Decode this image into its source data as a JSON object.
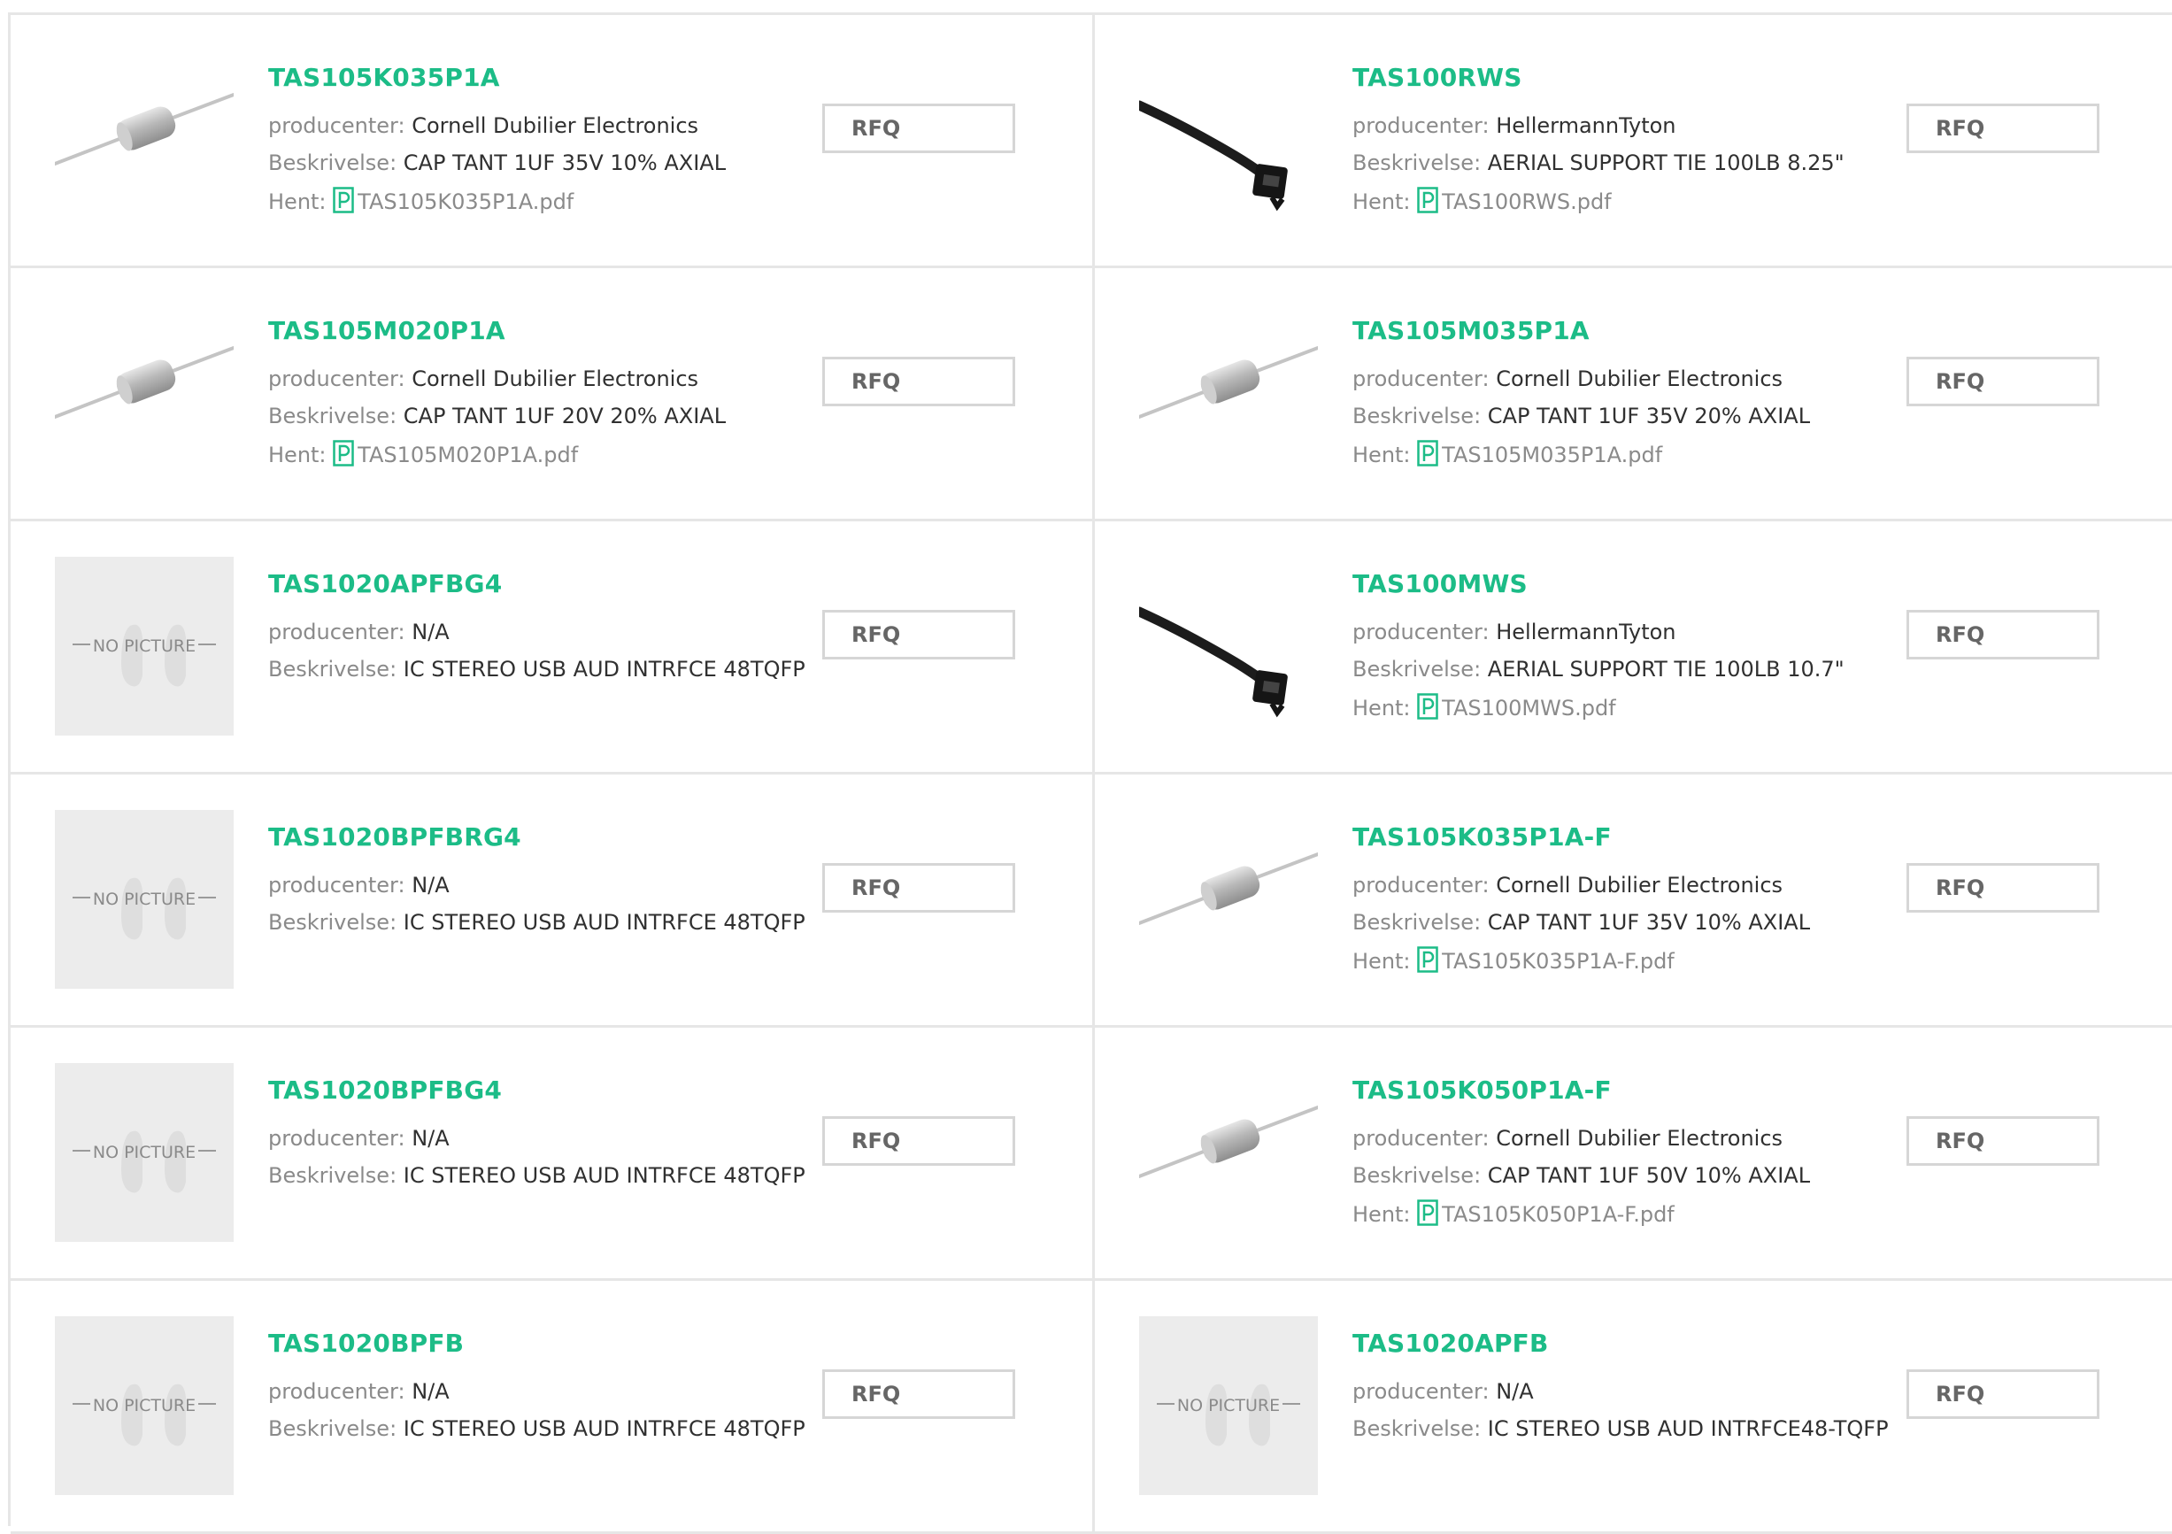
{
  "labels": {
    "manufacturer": "producenter:",
    "description": "Beskrivelse:",
    "download": "Hent:",
    "rfq": "RFQ",
    "no_picture": "NO PICTURE"
  },
  "colors": {
    "part_link": "#1cbc87",
    "label": "#8a8a8a",
    "value": "#303030",
    "border": "#e6e6e6"
  },
  "products": [
    {
      "part": "TAS105K035P1A",
      "manufacturer": "Cornell Dubilier Electronics",
      "description": "CAP TANT 1UF 35V 10% AXIAL",
      "pdf": "TAS105K035P1A.pdf",
      "image": "axial-capacitor"
    },
    {
      "part": "TAS100RWS",
      "manufacturer": "HellermannTyton",
      "description": "AERIAL SUPPORT TIE 100LB 8.25\"",
      "pdf": "TAS100RWS.pdf",
      "image": "cable-tie"
    },
    {
      "part": "TAS105M020P1A",
      "manufacturer": "Cornell Dubilier Electronics",
      "description": "CAP TANT 1UF 20V 20% AXIAL",
      "pdf": "TAS105M020P1A.pdf",
      "image": "axial-capacitor"
    },
    {
      "part": "TAS105M035P1A",
      "manufacturer": "Cornell Dubilier Electronics",
      "description": "CAP TANT 1UF 35V 20% AXIAL",
      "pdf": "TAS105M035P1A.pdf",
      "image": "axial-capacitor"
    },
    {
      "part": "TAS1020APFBG4",
      "manufacturer": "N/A",
      "description": "IC STEREO USB AUD INTRFCE 48TQFP",
      "image": "no-picture"
    },
    {
      "part": "TAS100MWS",
      "manufacturer": "HellermannTyton",
      "description": "AERIAL SUPPORT TIE 100LB 10.7\"",
      "pdf": "TAS100MWS.pdf",
      "image": "cable-tie"
    },
    {
      "part": "TAS1020BPFBRG4",
      "manufacturer": "N/A",
      "description": "IC STEREO USB AUD INTRFCE 48TQFP",
      "image": "no-picture"
    },
    {
      "part": "TAS105K035P1A-F",
      "manufacturer": "Cornell Dubilier Electronics",
      "description": "CAP TANT 1UF 35V 10% AXIAL",
      "pdf": "TAS105K035P1A-F.pdf",
      "image": "axial-capacitor"
    },
    {
      "part": "TAS1020BPFBG4",
      "manufacturer": "N/A",
      "description": "IC STEREO USB AUD INTRFCE 48TQFP",
      "image": "no-picture"
    },
    {
      "part": "TAS105K050P1A-F",
      "manufacturer": "Cornell Dubilier Electronics",
      "description": "CAP TANT 1UF 50V 10% AXIAL",
      "pdf": "TAS105K050P1A-F.pdf",
      "image": "axial-capacitor"
    },
    {
      "part": "TAS1020BPFB",
      "manufacturer": "N/A",
      "description": "IC STEREO USB AUD INTRFCE 48TQFP",
      "image": "no-picture"
    },
    {
      "part": "TAS1020APFB",
      "manufacturer": "N/A",
      "description": "IC STEREO USB AUD INTRFCE48-TQFP",
      "image": "no-picture"
    }
  ]
}
